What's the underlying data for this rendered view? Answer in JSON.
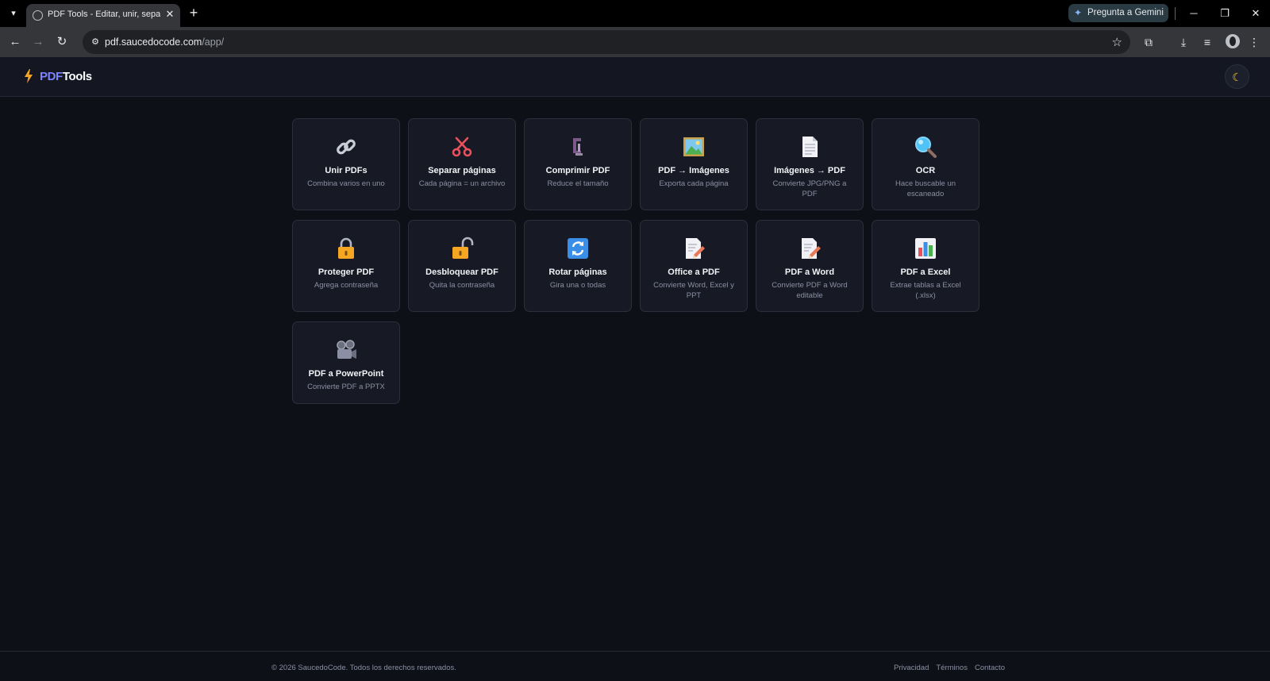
{
  "browser": {
    "tab_title": "PDF Tools - Editar, unir, separar",
    "gemini_label": "Pregunta a Gemini",
    "url_host": "pdf.saucedocode.com",
    "url_path": "/app/"
  },
  "app": {
    "logo_part1": "PDF",
    "logo_part2": "Tools",
    "theme_icon": "moon-icon"
  },
  "tools": [
    {
      "icon": "link-icon",
      "title": "Unir PDFs",
      "desc": "Combina varios en uno"
    },
    {
      "icon": "scissors-icon",
      "title": "Separar páginas",
      "desc": "Cada página = un archivo"
    },
    {
      "icon": "clamp-icon",
      "title": "Comprimir PDF",
      "desc": "Reduce el tamaño"
    },
    {
      "icon": "picture-icon",
      "title": "PDF → Imágenes",
      "desc": "Exporta cada página"
    },
    {
      "icon": "document-icon",
      "title": "Imágenes → PDF",
      "desc": "Convierte JPG/PNG a PDF"
    },
    {
      "icon": "magnifier-icon",
      "title": "OCR",
      "desc": "Hace buscable un escaneado"
    },
    {
      "icon": "lock-icon",
      "title": "Proteger PDF",
      "desc": "Agrega contraseña"
    },
    {
      "icon": "unlock-icon",
      "title": "Desbloquear PDF",
      "desc": "Quita la contraseña"
    },
    {
      "icon": "rotate-icon",
      "title": "Rotar páginas",
      "desc": "Gira una o todas"
    },
    {
      "icon": "memo-icon",
      "title": "Office a PDF",
      "desc": "Convierte Word, Excel y PPT"
    },
    {
      "icon": "memo-icon",
      "title": "PDF a Word",
      "desc": "Convierte PDF a Word editable"
    },
    {
      "icon": "bar-chart-icon",
      "title": "PDF a Excel",
      "desc": "Extrae tablas a Excel (.xlsx)"
    },
    {
      "icon": "projector-icon",
      "title": "PDF a PowerPoint",
      "desc": "Convierte PDF a PPTX"
    }
  ],
  "footer": {
    "copyright": "© 2026 SaucedoCode. Todos los derechos reservados.",
    "links": [
      "Privacidad",
      "Términos",
      "Contacto"
    ]
  }
}
